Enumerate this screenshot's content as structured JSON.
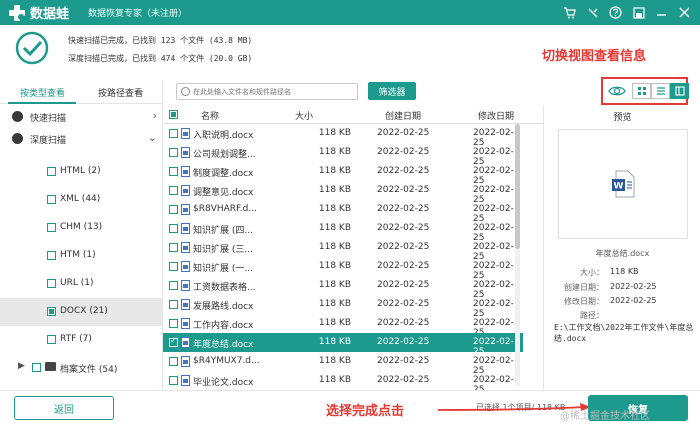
{
  "app": {
    "name": "数据蛙",
    "subtitle": "数据恢复专家（未注册）"
  },
  "summary": {
    "line1": "快速扫描已完成，已找到 123 个文件 (43.8 MB)",
    "line2": "深度扫描已完成，已找到 474 个文件 (20.0 GB)"
  },
  "annotations": {
    "view": "切换视图查看信息",
    "select": "选择完成点击"
  },
  "left_tabs": [
    {
      "label": "按类型查看",
      "active": true
    },
    {
      "label": "按路径查看",
      "active": false
    }
  ],
  "scan_groups": [
    {
      "label": "快速扫描",
      "chevron": "›"
    },
    {
      "label": "深度扫描",
      "chevron": "⌄"
    }
  ],
  "types": [
    {
      "label": "HTML (2)",
      "selected": false,
      "checked": false
    },
    {
      "label": "XML (44)",
      "selected": false,
      "checked": false
    },
    {
      "label": "CHM (13)",
      "selected": false,
      "checked": false
    },
    {
      "label": "HTM (1)",
      "selected": false,
      "checked": false
    },
    {
      "label": "URL (1)",
      "selected": false,
      "checked": false
    },
    {
      "label": "DOCX (21)",
      "selected": true,
      "checked": true
    },
    {
      "label": "RTF (7)",
      "selected": false,
      "checked": false
    }
  ],
  "archive": {
    "label": "档案文件 (54)"
  },
  "search": {
    "placeholder": "在此处输入文件名和规件路径名"
  },
  "filter_label": "筛选器",
  "table": {
    "headers": {
      "name": "名称",
      "size": "大小",
      "ctime": "创建日期",
      "mtime": "修改日期"
    },
    "rows": [
      {
        "name": "入职说明.docx",
        "size": "118 KB",
        "ctime": "2022-02-25",
        "mtime": "2022-02-25",
        "selected": false
      },
      {
        "name": "公司规划调整...",
        "size": "118 KB",
        "ctime": "2022-02-25",
        "mtime": "2022-02-25",
        "selected": false
      },
      {
        "name": "制度调整.docx",
        "size": "118 KB",
        "ctime": "2022-02-25",
        "mtime": "2022-02-25",
        "selected": false
      },
      {
        "name": "调整意见.docx",
        "size": "118 KB",
        "ctime": "2022-02-25",
        "mtime": "2022-02-25",
        "selected": false
      },
      {
        "name": "$R8VHARF.d...",
        "size": "118 KB",
        "ctime": "2022-02-25",
        "mtime": "2022-02-25",
        "selected": false
      },
      {
        "name": "知识扩展 (四...",
        "size": "118 KB",
        "ctime": "2022-02-25",
        "mtime": "2022-02-25",
        "selected": false
      },
      {
        "name": "知识扩展 (三...",
        "size": "118 KB",
        "ctime": "2022-02-25",
        "mtime": "2022-02-25",
        "selected": false
      },
      {
        "name": "知识扩展 (一...",
        "size": "118 KB",
        "ctime": "2022-02-25",
        "mtime": "2022-02-25",
        "selected": false
      },
      {
        "name": "工资数据表格...",
        "size": "118 KB",
        "ctime": "2022-02-25",
        "mtime": "2022-02-25",
        "selected": false
      },
      {
        "name": "发展路线.docx",
        "size": "118 KB",
        "ctime": "2022-02-25",
        "mtime": "2022-02-25",
        "selected": false
      },
      {
        "name": "工作内容.docx",
        "size": "118 KB",
        "ctime": "2022-02-25",
        "mtime": "2022-02-25",
        "selected": false
      },
      {
        "name": "年度总结.docx",
        "size": "118 KB",
        "ctime": "2022-02-25",
        "mtime": "2022-02-25",
        "selected": true
      },
      {
        "name": "$R4YMUX7.d...",
        "size": "118 KB",
        "ctime": "2022-02-25",
        "mtime": "2022-02-25",
        "selected": false
      },
      {
        "name": "毕业论文.docx",
        "size": "118 KB",
        "ctime": "2022-02-25",
        "mtime": "2022-02-25",
        "selected": false
      }
    ]
  },
  "preview": {
    "title": "预览",
    "file_name": "年度总结.docx",
    "size_label": "大小：",
    "size_value": "118 KB",
    "ctime_label": "创建日期：",
    "ctime_value": "2022-02-25",
    "mtime_label": "修改日期：",
    "mtime_value": "2022-02-25",
    "path_label": "路径：",
    "path_value": "E:\\工作文档\\2022年工作文件\\年度总结.docx"
  },
  "footer": {
    "back_label": "返回",
    "selected_info": "已选择 1个项目/ 118 KB",
    "restore_label": "恢复",
    "watermark": "@稀土掘金技术社区"
  },
  "colors": {
    "brand": "#1d9a8e",
    "annotation": "#e53935"
  }
}
